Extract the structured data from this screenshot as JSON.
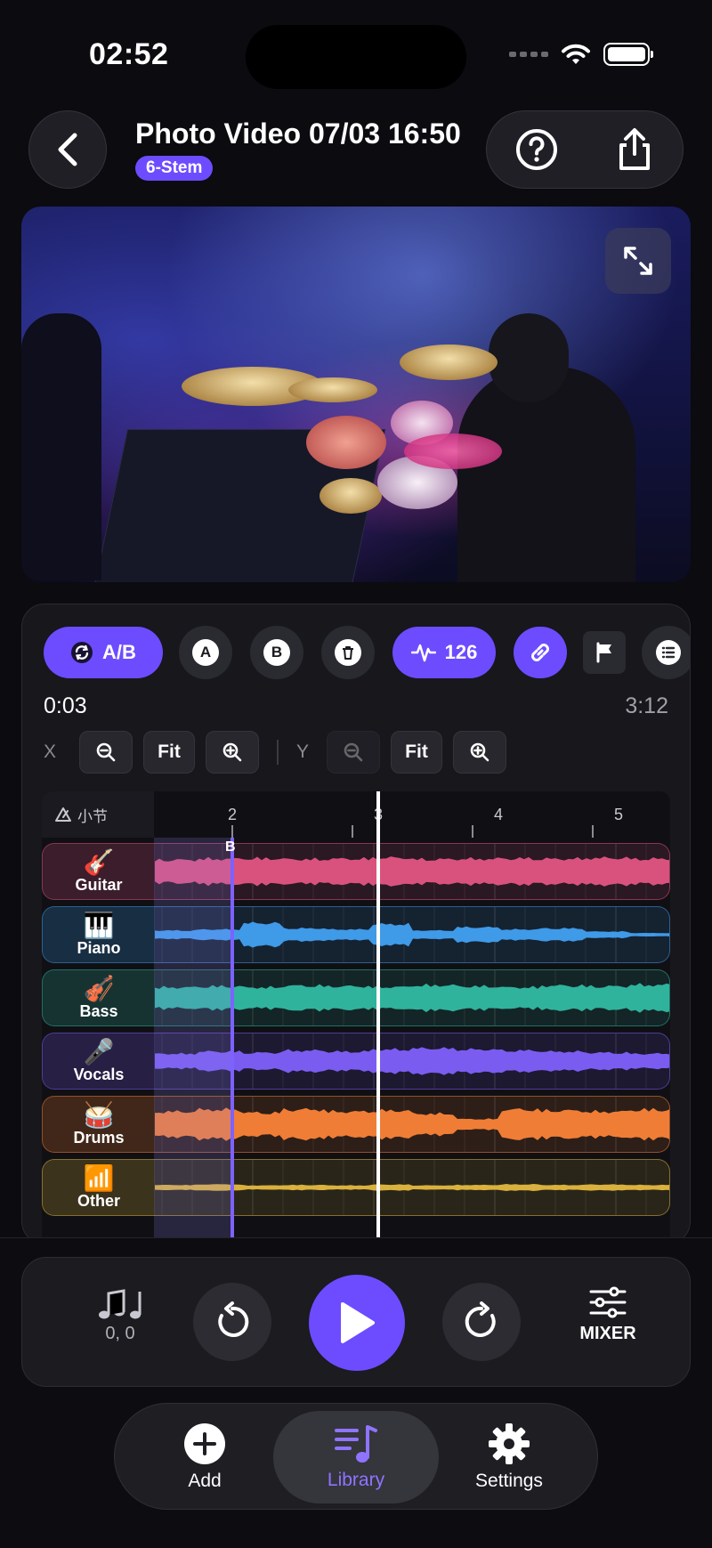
{
  "status": {
    "time": "02:52"
  },
  "header": {
    "title": "Photo Video 07/03 16:50",
    "badge": "6-Stem"
  },
  "toolbar": {
    "ab_label": "A/B",
    "a_label": "A",
    "b_label": "B",
    "bpm": "126"
  },
  "timeline": {
    "current": "0:03",
    "total": "3:12",
    "x_label": "X",
    "y_label": "Y",
    "fit_label": "Fit",
    "ruler_label": "小节",
    "bars": [
      "2",
      "3",
      "4",
      "5"
    ],
    "marker_b": "B"
  },
  "tracks": [
    {
      "name": "Guitar",
      "icon": "guitar-icon",
      "color": "#d9527d"
    },
    {
      "name": "Piano",
      "icon": "piano-icon",
      "color": "#3f9ae8"
    },
    {
      "name": "Bass",
      "icon": "bass-icon",
      "color": "#2fb39c"
    },
    {
      "name": "Vocals",
      "icon": "microphone-icon",
      "color": "#7b5cf0"
    },
    {
      "name": "Drums",
      "icon": "drum-icon",
      "color": "#f07d35"
    },
    {
      "name": "Other",
      "icon": "waveform-icon",
      "color": "#d9b13e"
    }
  ],
  "transport": {
    "pitch_value": "0, 0",
    "mixer_label": "MIXER"
  },
  "tabbar": {
    "add": "Add",
    "library": "Library",
    "settings": "Settings"
  },
  "colors": {
    "accent": "#6d4cff"
  }
}
